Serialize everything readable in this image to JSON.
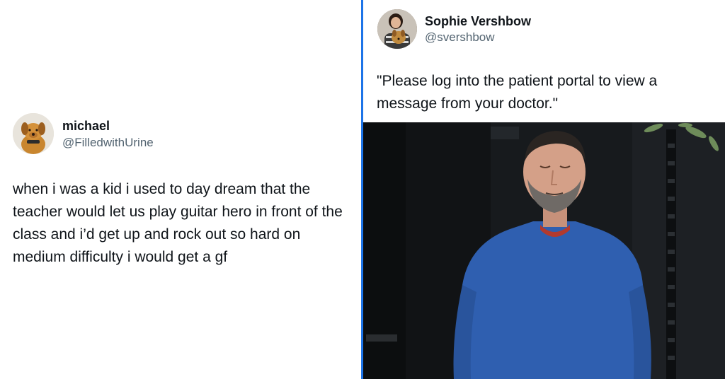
{
  "left_tweet": {
    "author_name": "michael",
    "author_handle": "@FilledwithUrine",
    "avatar_icon": "plush-dog-avatar",
    "text": "when i was a kid i used to day dream that the teacher would let us play guitar hero in front of the class and i’d get up and rock out so hard on medium difficulty i would get a gf"
  },
  "right_tweet": {
    "author_name": "Sophie Vershbow",
    "author_handle": "@svershbow",
    "avatar_icon": "woman-with-dog-avatar",
    "text": "\"Please log into the patient portal to view a message from your doctor.\"",
    "photo_icon": "man-eyes-closed-photo"
  },
  "colors": {
    "divider": "#1d74e8",
    "name": "#0f1419",
    "handle": "#536471",
    "sweater": "#2f5fb0"
  }
}
